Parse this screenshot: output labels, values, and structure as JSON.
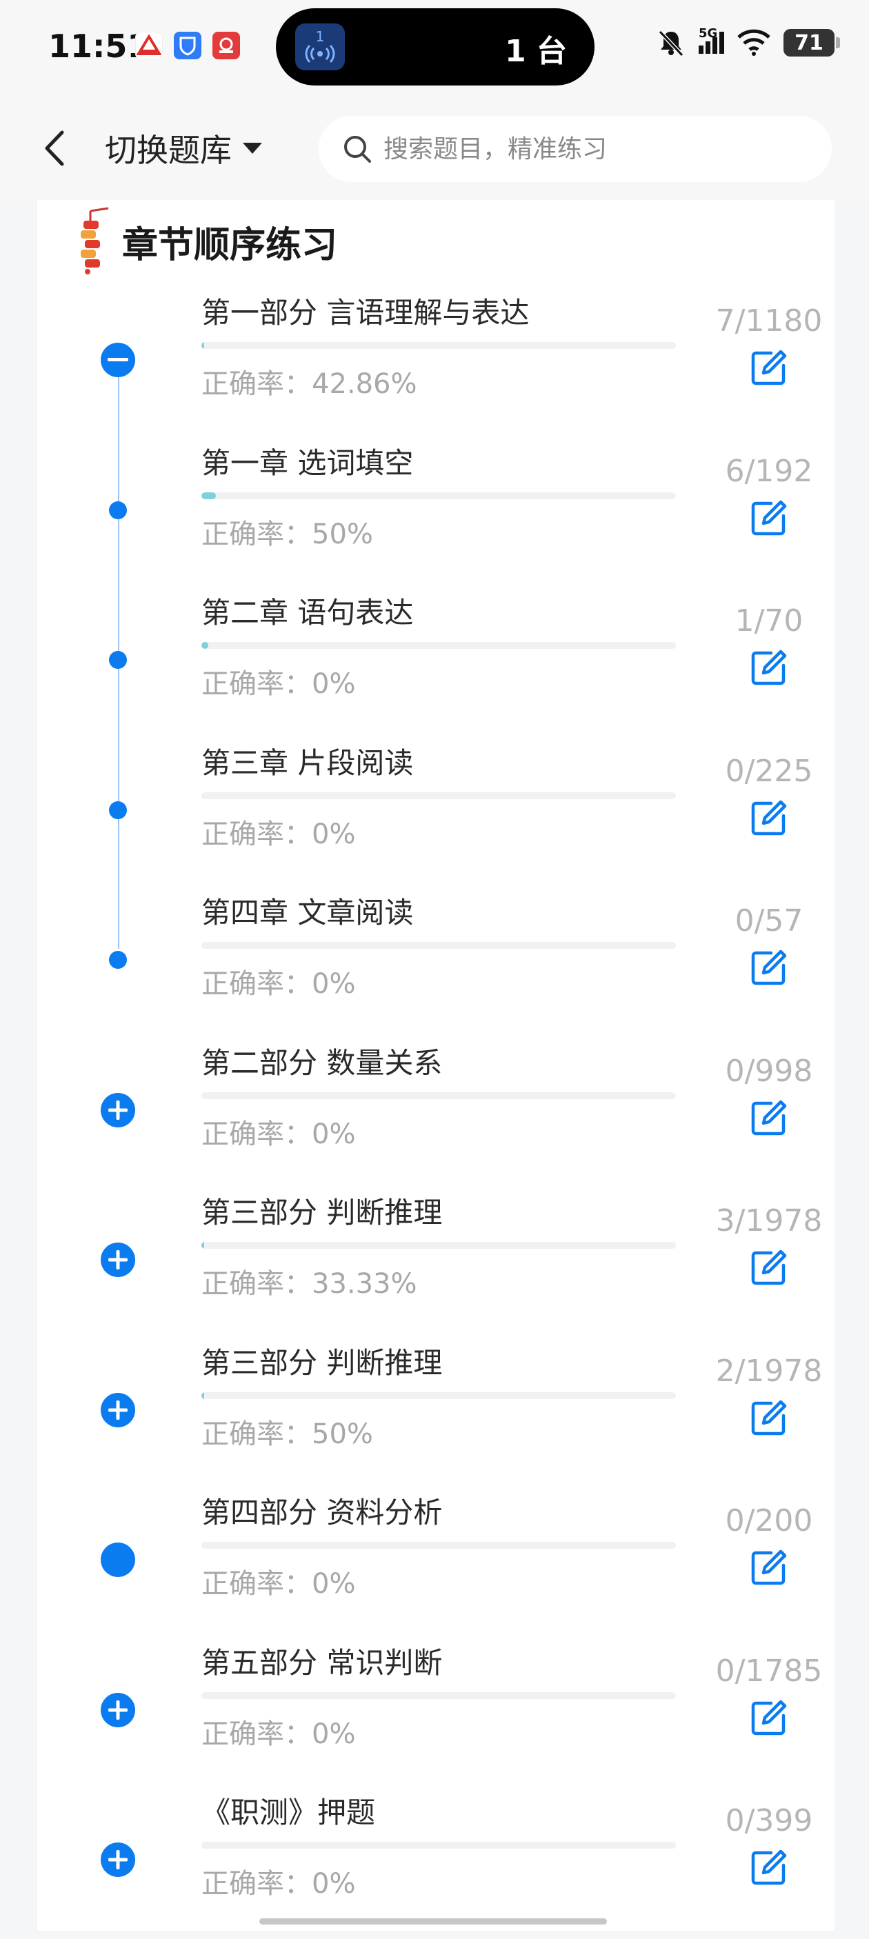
{
  "status_bar": {
    "time": "11:51",
    "island_number": "1",
    "island_text": "1 台",
    "network": "5G",
    "battery": "71"
  },
  "header": {
    "switch_bank_label": "切换题库",
    "search_placeholder": "搜索题目，精准练习"
  },
  "section": {
    "title": "章节顺序练习"
  },
  "rows": [
    {
      "title": "第一部分 言语理解与表达",
      "accuracy": "正确率：42.86%",
      "count": "7/1180",
      "progress": 0.006,
      "node": "minus"
    },
    {
      "title": "第一章 选词填空",
      "accuracy": "正确率：50%",
      "count": "6/192",
      "progress": 0.031,
      "node": "dot"
    },
    {
      "title": "第二章 语句表达",
      "accuracy": "正确率：0%",
      "count": "1/70",
      "progress": 0.014,
      "node": "dot"
    },
    {
      "title": "第三章 片段阅读",
      "accuracy": "正确率：0%",
      "count": "0/225",
      "progress": 0,
      "node": "dot"
    },
    {
      "title": "第四章 文章阅读",
      "accuracy": "正确率：0%",
      "count": "0/57",
      "progress": 0,
      "node": "dot"
    },
    {
      "title": "第二部分 数量关系",
      "accuracy": "正确率：0%",
      "count": "0/998",
      "progress": 0,
      "node": "plus"
    },
    {
      "title": "第三部分 判断推理",
      "accuracy": "正确率：33.33%",
      "count": "3/1978",
      "progress": 0.0015,
      "node": "plus"
    },
    {
      "title": "第三部分 判断推理",
      "accuracy": "正确率：50%",
      "count": "2/1978",
      "progress": 0.001,
      "node": "plus"
    },
    {
      "title": "第四部分 资料分析",
      "accuracy": "正确率：0%",
      "count": "0/200",
      "progress": 0,
      "node": "solid"
    },
    {
      "title": "第五部分 常识判断",
      "accuracy": "正确率：0%",
      "count": "0/1785",
      "progress": 0,
      "node": "plus"
    },
    {
      "title": "《职测》押题",
      "accuracy": "正确率：0%",
      "count": "0/399",
      "progress": 0,
      "node": "plus"
    }
  ],
  "colors": {
    "accent": "#0b7bf0",
    "progress": "#7fd0dc",
    "muted": "#a8a8a8"
  }
}
